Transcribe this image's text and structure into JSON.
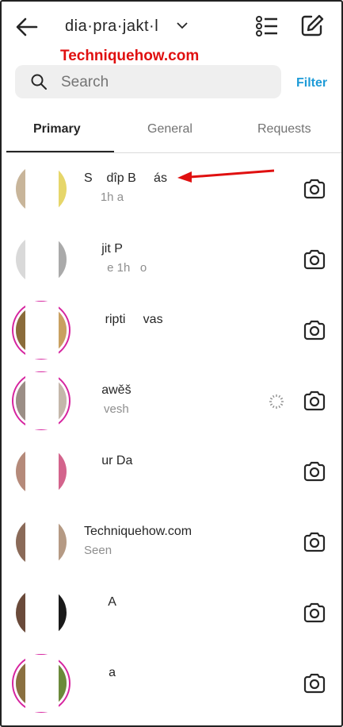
{
  "header": {
    "account_name": "dia·pra·jakt·l"
  },
  "watermark": "Techniquehow.com",
  "search": {
    "placeholder": "Search"
  },
  "filter_label": "Filter",
  "tabs": [
    {
      "label": "Primary",
      "active": true
    },
    {
      "label": "General",
      "active": false
    },
    {
      "label": "Requests",
      "active": false
    }
  ],
  "threads": [
    {
      "name": "S    dîp B     ás",
      "sub": "     1h a",
      "ring": false,
      "spinner": false,
      "avatar_color": "#c8b59a",
      "avatar_accent": "#e6d66a"
    },
    {
      "name": "     jit P",
      "sub": "       e 1h   o",
      "ring": false,
      "spinner": false,
      "avatar_color": "#d9d9d9",
      "avatar_accent": "#aaaaaa"
    },
    {
      "name": "      ripti     vas",
      "sub": "     ",
      "ring": true,
      "spinner": false,
      "avatar_color": "#8a6b3a",
      "avatar_accent": "#c9a060"
    },
    {
      "name": "     awěš",
      "sub": "      vesh",
      "ring": true,
      "spinner": true,
      "avatar_color": "#9b8e86",
      "avatar_accent": "#c4b7aa"
    },
    {
      "name": "     ur Da",
      "sub": "     ",
      "ring": false,
      "spinner": false,
      "avatar_color": "#b58a7a",
      "avatar_accent": "#d3648c"
    },
    {
      "name": "Techniquehow.com",
      "sub": "Seen",
      "ring": false,
      "spinner": false,
      "avatar_color": "#8a6a58",
      "avatar_accent": "#b59a84"
    },
    {
      "name": "       A",
      "sub": "",
      "ring": false,
      "spinner": false,
      "avatar_color": "#6a4a3a",
      "avatar_accent": "#1a1a1a"
    },
    {
      "name": "       a",
      "sub": "",
      "ring": true,
      "spinner": false,
      "avatar_color": "#8a7040",
      "avatar_accent": "#6b8a3a"
    }
  ],
  "colors": {
    "accent_blue": "#1e9bd7",
    "watermark_red": "#e01010",
    "ring": "#d6249f",
    "arrow": "#e01010"
  }
}
